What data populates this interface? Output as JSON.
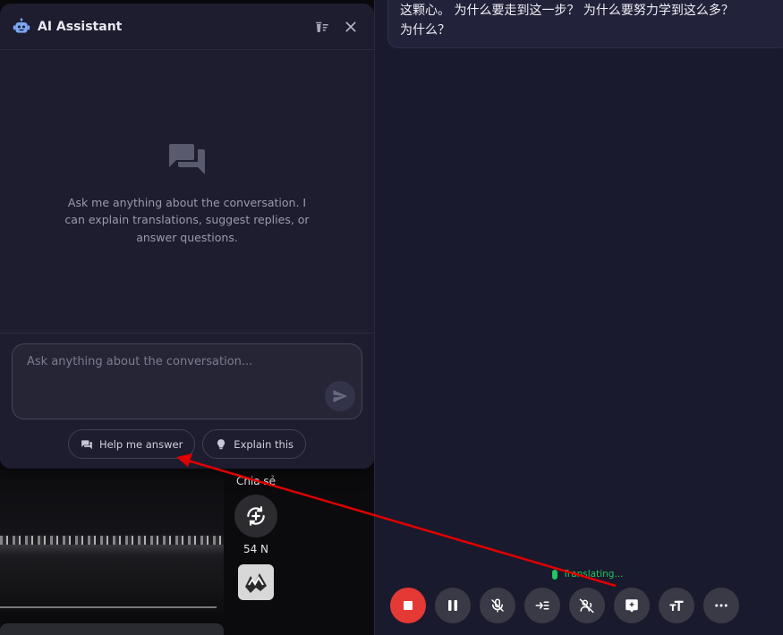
{
  "ai_panel": {
    "title": "AI Assistant",
    "icons": {
      "logo": "robot-icon",
      "clear": "clear-history-icon",
      "close": "close-icon"
    },
    "empty_state": {
      "icon": "chat-bubbles-icon",
      "text": "Ask me anything about the conversation. I can explain translations, suggest replies, or answer questions."
    },
    "input": {
      "placeholder": "Ask anything about the conversation...",
      "value": ""
    },
    "send_icon": "send-icon",
    "quick_actions": [
      {
        "label": "Help me answer",
        "icon": "chat-icon"
      },
      {
        "label": "Explain this",
        "icon": "lightbulb-icon"
      }
    ]
  },
  "video": {
    "share_label": "Chia sẻ",
    "share_icon": "share-rotate-icon",
    "count_label": "54 N",
    "music_icon": "music-disc-icon"
  },
  "translation_panel": {
    "message_text": "这颗心。 为什么要走到这一步？ 为什么要努力学到这么多？ 为什么？",
    "status_text": "Translating...",
    "status_color": "#22c55e",
    "controls": [
      {
        "name": "stop",
        "icon": "stop-icon"
      },
      {
        "name": "pause",
        "icon": "pause-icon"
      },
      {
        "name": "mute-mic",
        "icon": "mic-off-icon"
      },
      {
        "name": "insert",
        "icon": "insert-text-icon"
      },
      {
        "name": "voice-off",
        "icon": "voice-off-icon"
      },
      {
        "name": "ai-assistant",
        "icon": "ai-sparkle-icon"
      },
      {
        "name": "text-size",
        "icon": "text-size-icon"
      },
      {
        "name": "more",
        "icon": "more-horizontal-icon"
      }
    ]
  },
  "colors": {
    "accent_red": "#e53935",
    "panel_bg": "#1d1d2f",
    "annotation_arrow": "#e00000"
  }
}
